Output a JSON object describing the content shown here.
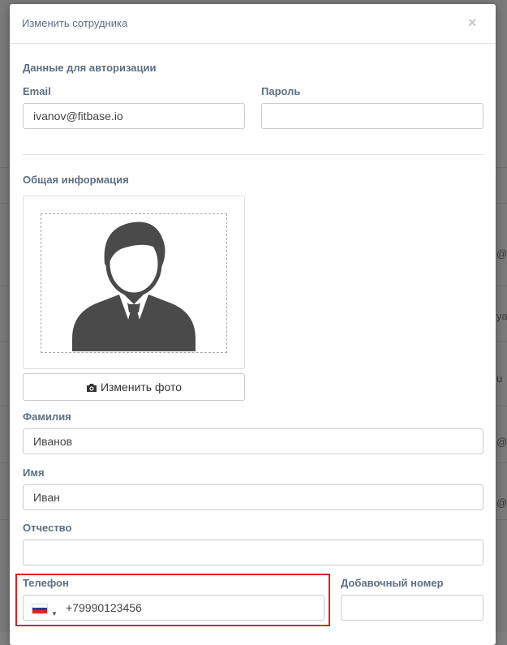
{
  "modal": {
    "title": "Изменить сотрудника",
    "close_glyph": "×"
  },
  "auth": {
    "section_title": "Данные для авторизации",
    "email_label": "Email",
    "email_value": "ivanov@fitbase.io",
    "password_label": "Пароль",
    "password_value": ""
  },
  "general": {
    "section_title": "Общая информация",
    "change_photo_label": "Изменить фото",
    "avatar_icon": "person-avatar-icon",
    "camera_icon": "camera-icon"
  },
  "fields": {
    "last_name_label": "Фамилия",
    "last_name_value": "Иванов",
    "first_name_label": "Имя",
    "first_name_value": "Иван",
    "patronymic_label": "Отчество",
    "patronymic_value": "",
    "phone_label": "Телефон",
    "phone_value": "+79990123456",
    "extension_label": "Добавочный номер",
    "extension_value": ""
  },
  "background": {
    "row_fragments": [
      "@",
      "ya",
      "u",
      "@g",
      "@g"
    ]
  },
  "colors": {
    "label": "#5e6e82",
    "highlight": "#e01f1f",
    "avatar": "#4a4a4a"
  }
}
